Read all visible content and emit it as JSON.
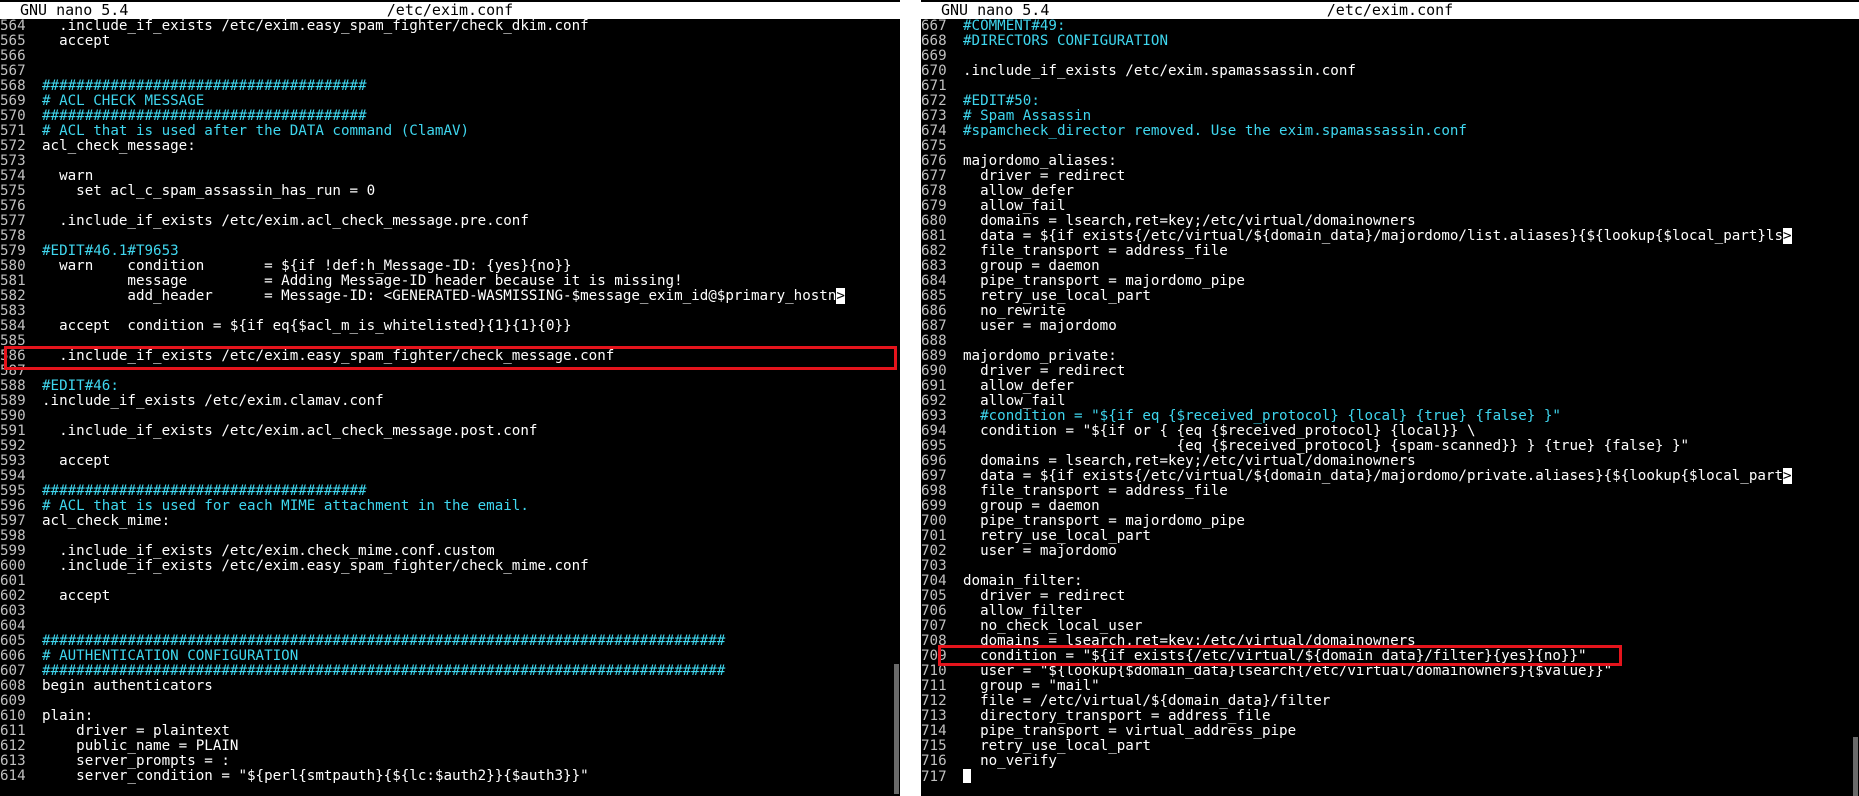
{
  "left": {
    "app": "GNU nano 5.4",
    "filename": "/etc/exim.conf",
    "lines": [
      {
        "n": "564",
        "t": "  .include_if_exists /etc/exim.easy_spam_fighter/check_dkim.conf",
        "c": "txt"
      },
      {
        "n": "565",
        "t": "  accept",
        "c": "txt"
      },
      {
        "n": "566",
        "t": "",
        "c": "txt"
      },
      {
        "n": "567",
        "t": "",
        "c": "txt"
      },
      {
        "n": "568",
        "t": "######################################",
        "c": "cmt"
      },
      {
        "n": "569",
        "t": "# ACL CHECK MESSAGE",
        "c": "cmt"
      },
      {
        "n": "570",
        "t": "######################################",
        "c": "cmt"
      },
      {
        "n": "571",
        "t": "# ACL that is used after the DATA command (ClamAV)",
        "c": "cmt"
      },
      {
        "n": "572",
        "t": "acl_check_message:",
        "c": "txt"
      },
      {
        "n": "573",
        "t": "",
        "c": "txt"
      },
      {
        "n": "574",
        "t": "  warn",
        "c": "txt"
      },
      {
        "n": "575",
        "t": "    set acl_c_spam_assassin_has_run = 0",
        "c": "txt"
      },
      {
        "n": "576",
        "t": "",
        "c": "txt"
      },
      {
        "n": "577",
        "t": "  .include_if_exists /etc/exim.acl_check_message.pre.conf",
        "c": "txt"
      },
      {
        "n": "578",
        "t": "",
        "c": "txt"
      },
      {
        "n": "579",
        "t": "#EDIT#46.1#T9653",
        "c": "cmt"
      },
      {
        "n": "580",
        "t": "  warn    condition       = ${if !def:h_Message-ID: {yes}{no}}",
        "c": "txt"
      },
      {
        "n": "581",
        "t": "          message         = Adding Message-ID header because it is missing!",
        "c": "txt"
      },
      {
        "n": "582",
        "t": "          add_header      = Message-ID: <GENERATED-WASMISSING-$message_exim_id@$primary_hostn",
        "c": "txt",
        "more": true
      },
      {
        "n": "583",
        "t": "",
        "c": "txt"
      },
      {
        "n": "584",
        "t": "  accept  condition = ${if eq{$acl_m_is_whitelisted}{1}{1}{0}}",
        "c": "txt"
      },
      {
        "n": "585",
        "t": "",
        "c": "txt"
      },
      {
        "n": "586",
        "t": "  .include_if_exists /etc/exim.easy_spam_fighter/check_message.conf",
        "c": "txt"
      },
      {
        "n": "587",
        "t": "",
        "c": "txt"
      },
      {
        "n": "588",
        "t": "#EDIT#46:",
        "c": "cmt"
      },
      {
        "n": "589",
        "t": ".include_if_exists /etc/exim.clamav.conf",
        "c": "txt"
      },
      {
        "n": "590",
        "t": "",
        "c": "txt"
      },
      {
        "n": "591",
        "t": "  .include_if_exists /etc/exim.acl_check_message.post.conf",
        "c": "txt"
      },
      {
        "n": "592",
        "t": "",
        "c": "txt"
      },
      {
        "n": "593",
        "t": "  accept",
        "c": "txt"
      },
      {
        "n": "594",
        "t": "",
        "c": "txt"
      },
      {
        "n": "595",
        "t": "######################################",
        "c": "cmt"
      },
      {
        "n": "596",
        "t": "# ACL that is used for each MIME attachment in the email.",
        "c": "cmt"
      },
      {
        "n": "597",
        "t": "acl_check_mime:",
        "c": "txt"
      },
      {
        "n": "598",
        "t": "",
        "c": "txt"
      },
      {
        "n": "599",
        "t": "  .include_if_exists /etc/exim.check_mime.conf.custom",
        "c": "txt"
      },
      {
        "n": "600",
        "t": "  .include_if_exists /etc/exim.easy_spam_fighter/check_mime.conf",
        "c": "txt"
      },
      {
        "n": "601",
        "t": "",
        "c": "txt"
      },
      {
        "n": "602",
        "t": "  accept",
        "c": "txt"
      },
      {
        "n": "603",
        "t": "",
        "c": "txt"
      },
      {
        "n": "604",
        "t": "",
        "c": "txt"
      },
      {
        "n": "605",
        "t": "################################################################################",
        "c": "cmt"
      },
      {
        "n": "606",
        "t": "# AUTHENTICATION CONFIGURATION",
        "c": "cmt"
      },
      {
        "n": "607",
        "t": "################################################################################",
        "c": "cmt"
      },
      {
        "n": "608",
        "t": "begin authenticators",
        "c": "txt"
      },
      {
        "n": "609",
        "t": "",
        "c": "txt"
      },
      {
        "n": "610",
        "t": "plain:",
        "c": "txt"
      },
      {
        "n": "611",
        "t": "    driver = plaintext",
        "c": "txt"
      },
      {
        "n": "612",
        "t": "    public_name = PLAIN",
        "c": "txt"
      },
      {
        "n": "613",
        "t": "    server_prompts = :",
        "c": "txt"
      },
      {
        "n": "614",
        "t": "    server_condition = \"${perl{smtpauth}{${lc:$auth2}}{$auth3}}\"",
        "c": "txt"
      }
    ]
  },
  "right": {
    "app": "GNU nano 5.4",
    "filename": "/etc/exim.conf",
    "lines": [
      {
        "n": "667",
        "t": "#COMMENT#49:",
        "c": "cmt"
      },
      {
        "n": "668",
        "t": "#DIRECTORS CONFIGURATION",
        "c": "cmt"
      },
      {
        "n": "669",
        "t": "",
        "c": "txt"
      },
      {
        "n": "670",
        "t": ".include_if_exists /etc/exim.spamassassin.conf",
        "c": "txt"
      },
      {
        "n": "671",
        "t": "",
        "c": "txt"
      },
      {
        "n": "672",
        "t": "#EDIT#50:",
        "c": "cmt"
      },
      {
        "n": "673",
        "t": "# Spam Assassin",
        "c": "cmt"
      },
      {
        "n": "674",
        "t": "#spamcheck_director removed. Use the exim.spamassassin.conf",
        "c": "cmt"
      },
      {
        "n": "675",
        "t": "",
        "c": "txt"
      },
      {
        "n": "676",
        "t": "majordomo_aliases:",
        "c": "txt"
      },
      {
        "n": "677",
        "t": "  driver = redirect",
        "c": "txt"
      },
      {
        "n": "678",
        "t": "  allow_defer",
        "c": "txt"
      },
      {
        "n": "679",
        "t": "  allow_fail",
        "c": "txt"
      },
      {
        "n": "680",
        "t": "  domains = lsearch,ret=key;/etc/virtual/domainowners",
        "c": "txt"
      },
      {
        "n": "681",
        "t": "  data = ${if exists{/etc/virtual/${domain_data}/majordomo/list.aliases}{${lookup{$local_part}ls",
        "c": "txt",
        "more": true
      },
      {
        "n": "682",
        "t": "  file_transport = address_file",
        "c": "txt"
      },
      {
        "n": "683",
        "t": "  group = daemon",
        "c": "txt"
      },
      {
        "n": "684",
        "t": "  pipe_transport = majordomo_pipe",
        "c": "txt"
      },
      {
        "n": "685",
        "t": "  retry_use_local_part",
        "c": "txt"
      },
      {
        "n": "686",
        "t": "  no_rewrite",
        "c": "txt"
      },
      {
        "n": "687",
        "t": "  user = majordomo",
        "c": "txt"
      },
      {
        "n": "688",
        "t": "",
        "c": "txt"
      },
      {
        "n": "689",
        "t": "majordomo_private:",
        "c": "txt"
      },
      {
        "n": "690",
        "t": "  driver = redirect",
        "c": "txt"
      },
      {
        "n": "691",
        "t": "  allow_defer",
        "c": "txt"
      },
      {
        "n": "692",
        "t": "  allow_fail",
        "c": "txt"
      },
      {
        "n": "693",
        "t": "  #condition = \"${if eq {$received_protocol} {local} {true} {false} }\"",
        "c": "cmt"
      },
      {
        "n": "694",
        "t": "  condition = \"${if or { {eq {$received_protocol} {local}} \\",
        "c": "txt"
      },
      {
        "n": "695",
        "t": "                         {eq {$received_protocol} {spam-scanned}} } {true} {false} }\"",
        "c": "txt"
      },
      {
        "n": "696",
        "t": "  domains = lsearch,ret=key;/etc/virtual/domainowners",
        "c": "txt"
      },
      {
        "n": "697",
        "t": "  data = ${if exists{/etc/virtual/${domain_data}/majordomo/private.aliases}{${lookup{$local_part",
        "c": "txt",
        "more": true
      },
      {
        "n": "698",
        "t": "  file_transport = address_file",
        "c": "txt"
      },
      {
        "n": "699",
        "t": "  group = daemon",
        "c": "txt"
      },
      {
        "n": "700",
        "t": "  pipe_transport = majordomo_pipe",
        "c": "txt"
      },
      {
        "n": "701",
        "t": "  retry_use_local_part",
        "c": "txt"
      },
      {
        "n": "702",
        "t": "  user = majordomo",
        "c": "txt"
      },
      {
        "n": "703",
        "t": "",
        "c": "txt"
      },
      {
        "n": "704",
        "t": "domain_filter:",
        "c": "txt"
      },
      {
        "n": "705",
        "t": "  driver = redirect",
        "c": "txt"
      },
      {
        "n": "706",
        "t": "  allow_filter",
        "c": "txt"
      },
      {
        "n": "707",
        "t": "  no_check_local_user",
        "c": "txt"
      },
      {
        "n": "708",
        "t": "  domains = lsearch,ret=key;/etc/virtual/domainowners",
        "c": "txt"
      },
      {
        "n": "709",
        "t": "  condition = \"${if exists{/etc/virtual/${domain_data}/filter}{yes}{no}}\"",
        "c": "txt"
      },
      {
        "n": "710",
        "t": "  user = \"${lookup{$domain_data}lsearch{/etc/virtual/domainowners}{$value}}\"",
        "c": "txt"
      },
      {
        "n": "711",
        "t": "  group = \"mail\"",
        "c": "txt"
      },
      {
        "n": "712",
        "t": "  file = /etc/virtual/${domain_data}/filter",
        "c": "txt"
      },
      {
        "n": "713",
        "t": "  directory_transport = address_file",
        "c": "txt"
      },
      {
        "n": "714",
        "t": "  pipe_transport = virtual_address_pipe",
        "c": "txt"
      },
      {
        "n": "715",
        "t": "  retry_use_local_part",
        "c": "txt"
      },
      {
        "n": "716",
        "t": "  no_verify",
        "c": "txt"
      },
      {
        "n": "717",
        "t": "",
        "c": "txt",
        "cursor": true
      }
    ]
  },
  "icons": {
    "more_indicator": ">"
  },
  "colors": {
    "background": "#000000",
    "text": "#ffffff",
    "comment": "#3fd6ee",
    "highlight_box": "#e5141c",
    "titlebar_bg": "#ffffff"
  }
}
